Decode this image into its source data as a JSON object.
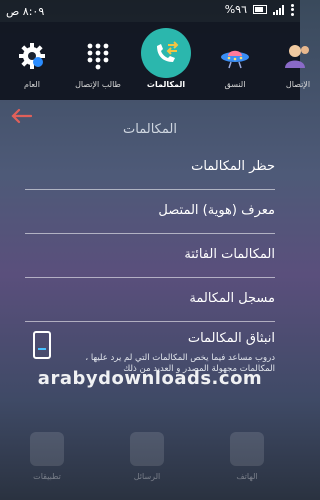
{
  "status_bar": {
    "time": "٨:٠٩ ص",
    "battery": "%٩٦"
  },
  "tabs": [
    {
      "label": "العام",
      "icon": "gear-icon"
    },
    {
      "label": "طالب الإتصال",
      "icon": "dialpad-icon"
    },
    {
      "label": "المكالمات",
      "icon": "phone-swap-icon",
      "active": true
    },
    {
      "label": "النسق",
      "icon": "ufo-icon"
    },
    {
      "label": "الإتصال",
      "icon": "contacts-icon"
    }
  ],
  "header": {
    "title": "المكالمات",
    "back_icon": "back-arrow-icon"
  },
  "settings": {
    "items": [
      {
        "label": "حظر المكالمات"
      },
      {
        "label": "معرف (هوية) المتصل"
      },
      {
        "label": "المكالمات الفائتة"
      },
      {
        "label": "مسجل المكالمة"
      },
      {
        "label": "انبثاق المكالمات",
        "description": "دروب مساعد فيما يخص المكالمات التي لم يرد عليها ، المكالمات مجهولة المصدر و العديد من ذلك"
      }
    ]
  },
  "watermark": "arabydownloads.com",
  "dock": {
    "labels": [
      "تطبيقات",
      "الرسائل",
      "الهاتف"
    ]
  },
  "colors": {
    "accent": "#2bb7ad",
    "back_arrow": "#e0605a"
  }
}
